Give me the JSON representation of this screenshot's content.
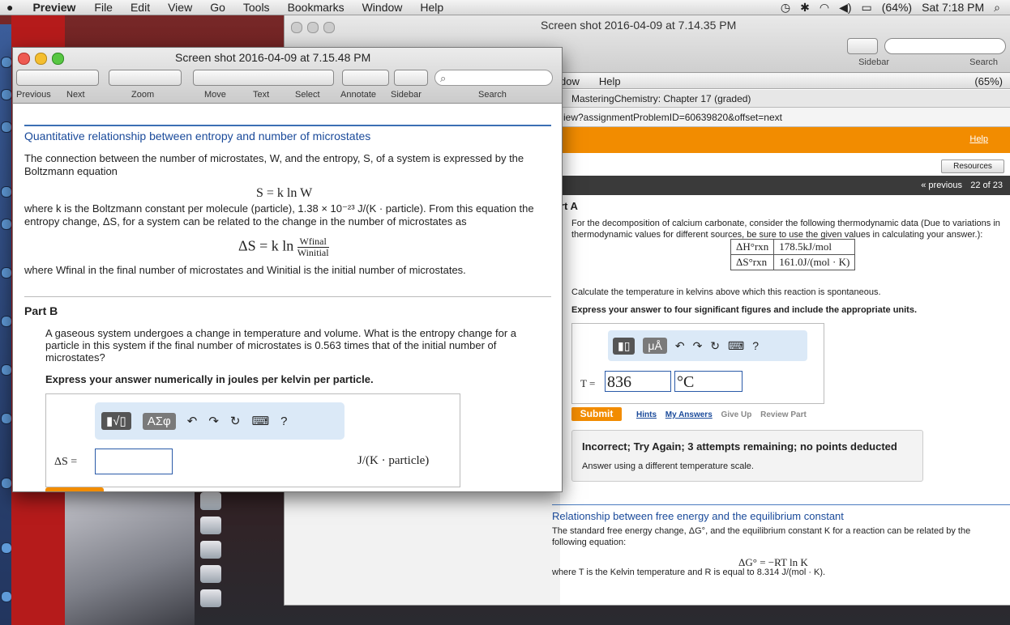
{
  "menubar": {
    "app": "Preview",
    "items": [
      "File",
      "Edit",
      "View",
      "Go",
      "Tools",
      "Bookmarks",
      "Window",
      "Help"
    ],
    "battery": "(64%)",
    "clock": "Sat 7:18 PM"
  },
  "back_window": {
    "title": "Screen shot 2016-04-09 at 7.14.35 PM",
    "sidebar_label": "Sidebar",
    "search_label": "Search",
    "inner_menubar": [
      "dow",
      "Help"
    ],
    "inner_battery": "(65%)",
    "page_title": "MasteringChemistry: Chapter 17 (graded)",
    "url": "iew?assignmentProblemID=60639820&offset=next",
    "help_link": "Help",
    "resources_button": "Resources",
    "previous_link": "« previous",
    "counter": "22 of 23",
    "part_label": "rt A",
    "question": "For the decomposition of calcium carbonate, consider the following thermodynamic data (Due to variations in thermodynamic values for different sources, be sure to use the given values in calculating your answer.):",
    "thermo_rows": [
      {
        "label": "ΔH°rxn",
        "value": "178.5kJ/mol"
      },
      {
        "label": "ΔS°rxn",
        "value": "161.0J/(mol · K)"
      }
    ],
    "task": "Calculate the temperature in kelvins above which this reaction is spontaneous.",
    "instruction": "Express your answer to four significant figures and include the appropriate units.",
    "toolbar_unit_button": "μÅ",
    "answer_label": "T =",
    "answer_value": "836",
    "answer_unit": "°C",
    "submit_label": "Submit",
    "links": [
      "Hints",
      "My Answers",
      "Give Up",
      "Review Part"
    ],
    "feedback_title": "Incorrect; Try Again; 3 attempts remaining; no points deducted",
    "feedback_text": "Answer using a different temperature scale.",
    "next_title": "Relationship between free energy and the equilibrium constant",
    "next_text": "The standard free energy change, ΔG°, and the equilibrium constant K for a reaction can be related by the following equation:",
    "next_equation": "ΔG° = −RT ln K",
    "next_text2": "where T is the Kelvin temperature and R is equal to 8.314 J/(mol · K)."
  },
  "front_window": {
    "title": "Screen shot 2016-04-09 at 7.15.48 PM",
    "toolbar_labels": [
      "Previous",
      "Next",
      "Zoom",
      "Move",
      "Text",
      "Select",
      "Annotate",
      "Sidebar",
      "Search"
    ],
    "question_title": "Quantitative relationship between entropy and number of microstates",
    "p1": "The connection between the number of microstates, W, and the entropy, S, of a system is expressed by the Boltzmann equation",
    "eq1": "S = k ln W",
    "p2": "where k is the Boltzmann constant per molecule (particle), 1.38 × 10⁻²³ J/(K · particle). From this equation the entropy change, ΔS, for a system can be related to the change in the number of microstates as",
    "eq2_left": "ΔS = k ln",
    "eq2_num": "Wfinal",
    "eq2_den": "Winitial",
    "p3": "where Wfinal in the final number of microstates and Winitial is the initial number of microstates.",
    "part_b": "Part B",
    "question": "A gaseous system undergoes a change in temperature and volume. What is the entropy change for a particle in this system if the final number of microstates is 0.563 times that of the initial number of microstates?",
    "instruction": "Express your answer numerically in joules per kelvin per particle.",
    "toolbar_greek": "ΑΣφ",
    "answer_label": "ΔS =",
    "answer_unit": "J/(K · particle)"
  }
}
